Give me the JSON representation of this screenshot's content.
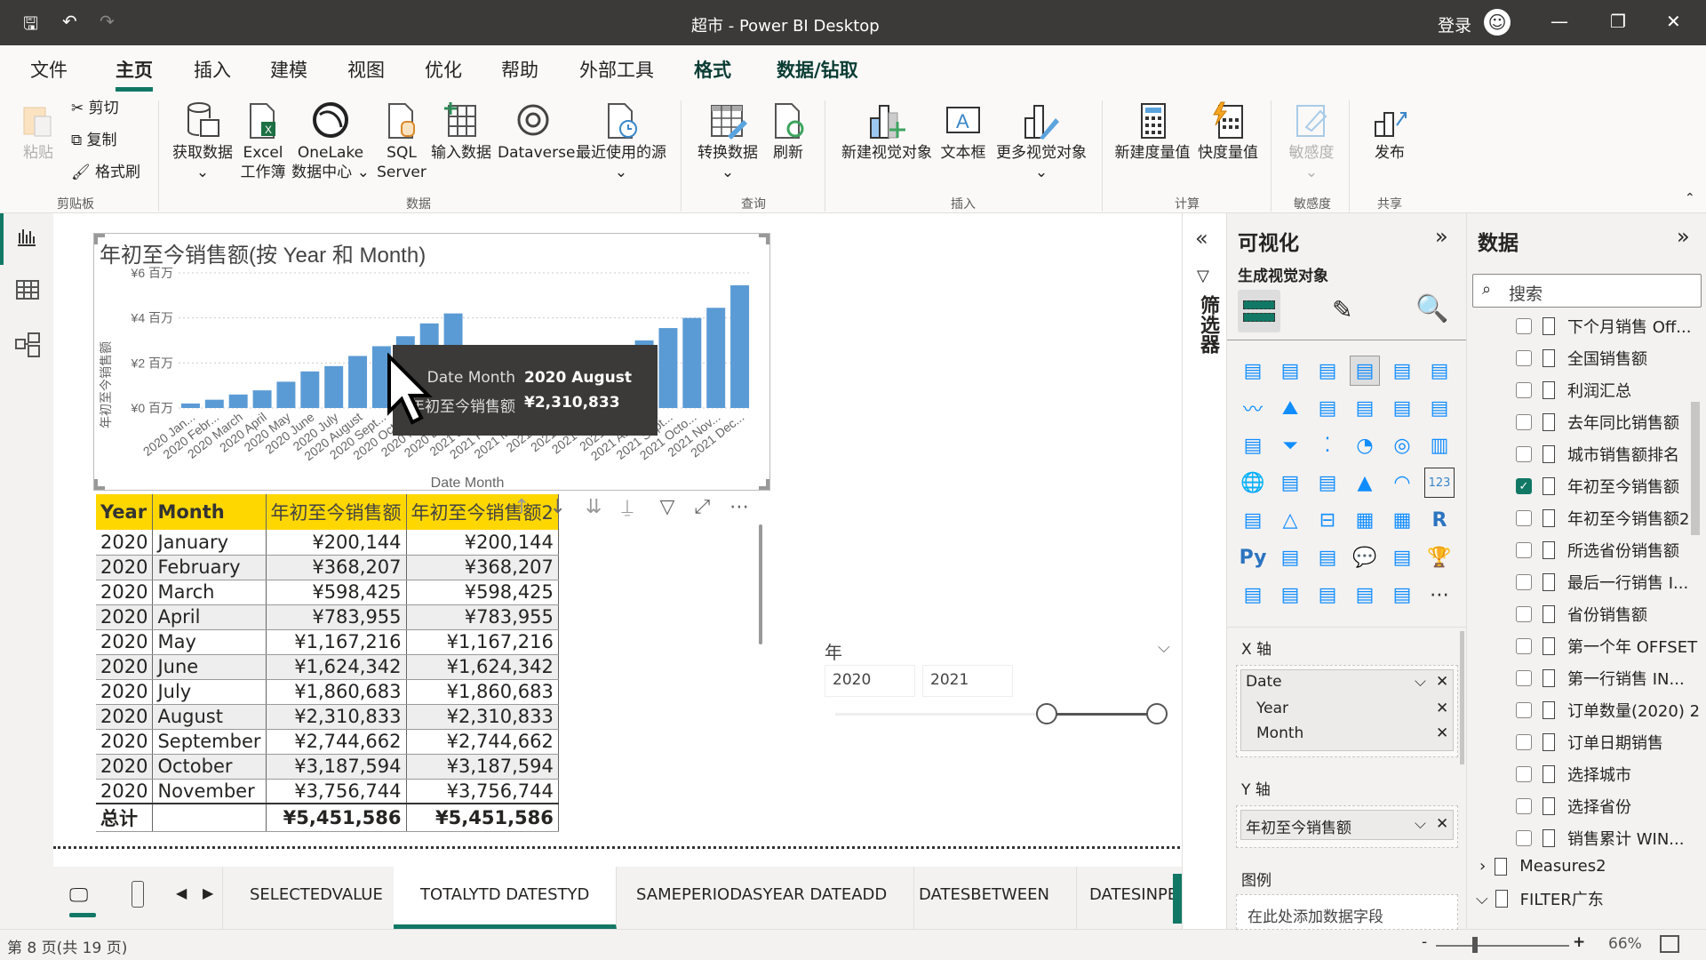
{
  "titlebar": {
    "title": "超市 - Power BI Desktop",
    "signin": "登录"
  },
  "menu": {
    "items": [
      "文件",
      "主页",
      "插入",
      "建模",
      "视图",
      "优化",
      "帮助",
      "外部工具",
      "格式",
      "数据/钻取"
    ],
    "active": "主页"
  },
  "ribbon": {
    "clipboard": {
      "paste": "粘贴",
      "cut": "剪切",
      "copy": "复制",
      "format_painter": "格式刷",
      "group": "剪贴板"
    },
    "data": {
      "get_data": "获取数据",
      "excel_1": "Excel",
      "excel_2": "工作簿",
      "onelake_1": "OneLake",
      "onelake_2": "数据中心",
      "sql_1": "SQL",
      "sql_2": "Server",
      "enter_data": "输入数据",
      "dataverse": "Dataverse",
      "recent": "最近使用的源",
      "group": "数据"
    },
    "query": {
      "transform": "转换数据",
      "refresh": "刷新",
      "group": "查询"
    },
    "insert": {
      "new_visual": "新建视觉对象",
      "textbox": "文本框",
      "more_visuals": "更多视觉对象",
      "group": "插入"
    },
    "calc": {
      "new_measure": "新建度量值",
      "quick_measure": "快度量值",
      "group": "计算"
    },
    "sensitivity": {
      "label": "敏感度",
      "group": "敏感度"
    },
    "share": {
      "publish": "发布",
      "group": "共享"
    }
  },
  "chart_data": {
    "type": "bar",
    "title": "年初至今销售额(按 Year 和 Month)",
    "xlabel": "Date Month",
    "ylabel": "年初至今销售额",
    "ylim": [
      0,
      6000000
    ],
    "yticks": [
      "¥0 百万",
      "¥2 百万",
      "¥4 百万",
      "¥6 百万"
    ],
    "ytick_values": [
      0,
      2000000,
      4000000,
      6000000
    ],
    "grid": true,
    "categories": [
      "2020 Jan...",
      "2020 Febr...",
      "2020 March",
      "2020 April",
      "2020 May",
      "2020 June",
      "2020 July",
      "2020 August",
      "2020 Sept...",
      "2020 Octo...",
      "2020 Nov...",
      "2020 Dec...",
      "2021 Jan...",
      "2021 Febr...",
      "2021 March",
      "2021 April",
      "2021 May",
      "2021 June",
      "2021 July",
      "2021 August",
      "2021 Sept...",
      "2021 Octo...",
      "2021 Nov...",
      "2021 Dec..."
    ],
    "values": [
      200144,
      368207,
      598425,
      783955,
      1167216,
      1624342,
      1860683,
      2310833,
      2744662,
      3187594,
      3756744,
      4200000,
      250000,
      450000,
      700000,
      950000,
      1300000,
      1750000,
      2600000,
      3000000,
      3550000,
      4000000,
      4450000,
      5451586
    ],
    "color": "#5b9bd5",
    "tooltip": {
      "label1": "Date Month",
      "value1": "2020 August",
      "label2": "年初至今销售额",
      "value2": "¥2,310,833"
    }
  },
  "table": {
    "headers": [
      "Year",
      "Month",
      "年初至今销售额",
      "年初至今销售额2"
    ],
    "rows": [
      [
        "2020",
        "January",
        "¥200,144",
        "¥200,144"
      ],
      [
        "2020",
        "February",
        "¥368,207",
        "¥368,207"
      ],
      [
        "2020",
        "March",
        "¥598,425",
        "¥598,425"
      ],
      [
        "2020",
        "April",
        "¥783,955",
        "¥783,955"
      ],
      [
        "2020",
        "May",
        "¥1,167,216",
        "¥1,167,216"
      ],
      [
        "2020",
        "June",
        "¥1,624,342",
        "¥1,624,342"
      ],
      [
        "2020",
        "July",
        "¥1,860,683",
        "¥1,860,683"
      ],
      [
        "2020",
        "August",
        "¥2,310,833",
        "¥2,310,833"
      ],
      [
        "2020",
        "September",
        "¥2,744,662",
        "¥2,744,662"
      ],
      [
        "2020",
        "October",
        "¥3,187,594",
        "¥3,187,594"
      ],
      [
        "2020",
        "November",
        "¥3,756,744",
        "¥3,756,744"
      ]
    ],
    "total": [
      "总计",
      "",
      "¥5,451,586",
      "¥5,451,586"
    ]
  },
  "slicer": {
    "title": "年",
    "from": "2020",
    "to": "2021",
    "range": [
      2020,
      2021
    ]
  },
  "filters": {
    "label": "筛选器"
  },
  "viz": {
    "title": "可视化",
    "subtitle": "生成视觉对象",
    "x_axis": "X 轴",
    "x_fields": [
      "Date",
      "Year",
      "Month"
    ],
    "y_axis": "Y 轴",
    "y_fields": [
      "年初至今销售额"
    ],
    "legend": "图例",
    "legend_placeholder": "在此处添加数据字段"
  },
  "datapane": {
    "title": "数据",
    "search_placeholder": "搜索",
    "fields": [
      {
        "name": "下个月销售 Off...",
        "checked": false
      },
      {
        "name": "全国销售额",
        "checked": false
      },
      {
        "name": "利润汇总",
        "checked": false
      },
      {
        "name": "去年同比销售额",
        "checked": false
      },
      {
        "name": "城市销售额排名",
        "checked": false
      },
      {
        "name": "年初至今销售额",
        "checked": true
      },
      {
        "name": "年初至今销售额2",
        "checked": false
      },
      {
        "name": "所选省份销售额",
        "checked": false
      },
      {
        "name": "最后一行销售 I...",
        "checked": false
      },
      {
        "name": "省份销售额",
        "checked": false
      },
      {
        "name": "第一个年 OFFSET",
        "checked": false
      },
      {
        "name": "第一行销售 IN...",
        "checked": false
      },
      {
        "name": "订单数量(2020) 2",
        "checked": false
      },
      {
        "name": "订单日期销售",
        "checked": false
      },
      {
        "name": "选择城市",
        "checked": false
      },
      {
        "name": "选择省份",
        "checked": false
      },
      {
        "name": "销售累计 WIN...",
        "checked": false
      }
    ],
    "tables": [
      "Measures2",
      "FILTER广东"
    ]
  },
  "tabs": {
    "items": [
      "SELECTEDVALUE",
      "TOTALYTD DATESTYD",
      "SAMEPERIODASYEAR DATEADD",
      "DATESBETWEEN",
      "DATESINPERIO"
    ],
    "active": 1
  },
  "status": {
    "page": "第 8 页(共 19 页)",
    "zoom": "66%"
  }
}
